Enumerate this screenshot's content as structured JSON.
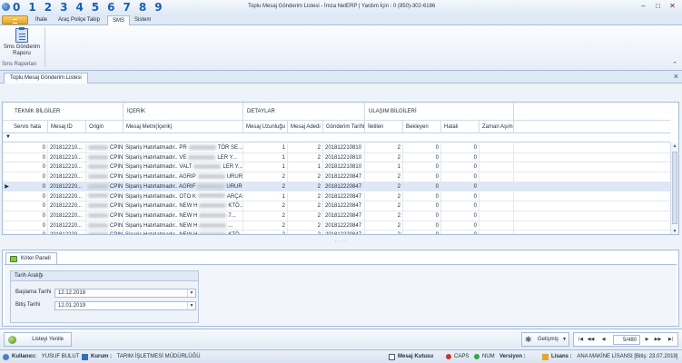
{
  "titlebar": {
    "digits": [
      "0",
      "1",
      "2",
      "3",
      "4",
      "5",
      "6",
      "7",
      "8",
      "9"
    ],
    "title": "Toplu Mesaj Gönderim Listesi - İmza NetERP | Yardım İçin :  0 (850)-302-6186"
  },
  "ribbon": {
    "tabs": [
      "İhale",
      "Araç Poliçe Takip",
      "SMS",
      "Sistem"
    ],
    "active_tab": "SMS",
    "button_label_1": "Sms Gönderim",
    "button_label_2": "Raporu",
    "group_label": "Sms Raporları"
  },
  "document_tab": "Toplu Mesaj Gönderim Listesi",
  "grid": {
    "bands": [
      "TEKNİK BİLGİLER",
      "İÇERİK",
      "DETAYLAR",
      "ULAŞIM BİLGİLERİ"
    ],
    "columns": [
      "Servis hata",
      "Mesaj ID",
      "Origin",
      "Mesaj Metni(İçerik)",
      "Mesaj Uzunluğu",
      "Mesaj Adedi",
      "Gönderim Tarihi",
      "İletilen",
      "Bekleyen",
      "Hatalı",
      "Zaman Aşımı"
    ],
    "rows": [
      {
        "servis": "0",
        "id": "201812210...",
        "origin": "CPIN...",
        "text_a": "Sipariş Hatırlatmadır.. PR",
        "text_b": "TÖR SE...",
        "uzunluk": "1",
        "adet": "2",
        "tarih": "201812210810",
        "iletilen": "2",
        "bekleyen": "0",
        "hatali": "0"
      },
      {
        "servis": "0",
        "id": "201812210...",
        "origin": "CPIN...",
        "text_a": "Sipariş Hatırlatmadır.. VE",
        "text_b": "LER Y...",
        "uzunluk": "1",
        "adet": "2",
        "tarih": "201812210810",
        "iletilen": "2",
        "bekleyen": "0",
        "hatali": "0"
      },
      {
        "servis": "0",
        "id": "201812210...",
        "origin": "CPIN...",
        "text_a": "Sipariş Hatırlatmadır.. VALT",
        "text_b": "LER Y...",
        "uzunluk": "1",
        "adet": "1",
        "tarih": "201812210810",
        "iletilen": "1",
        "bekleyen": "0",
        "hatali": "0"
      },
      {
        "servis": "0",
        "id": "201812220...",
        "origin": "CPIN...",
        "text_a": "Sipariş Hatırlatmadır.. AGRIP",
        "text_b": "URUR ...",
        "uzunluk": "2",
        "adet": "2",
        "tarih": "201812220847",
        "iletilen": "2",
        "bekleyen": "0",
        "hatali": "0"
      },
      {
        "servis": "0",
        "id": "201812220...",
        "origin": "CPIN...",
        "text_a": "Sipariş Hatırlatmadır.. AGRIF",
        "text_b": "URUR ...",
        "uzunluk": "2",
        "adet": "2",
        "tarih": "201812220847",
        "iletilen": "2",
        "bekleyen": "0",
        "hatali": "0"
      },
      {
        "servis": "0",
        "id": "201812220...",
        "origin": "CPIN...",
        "text_a": "Sipariş Hatırlatmadır.. OTO K",
        "text_b": "ARÇAL...",
        "uzunluk": "1",
        "adet": "2",
        "tarih": "201812220847",
        "iletilen": "2",
        "bekleyen": "0",
        "hatali": "0"
      },
      {
        "servis": "0",
        "id": "201812220...",
        "origin": "CPIN...",
        "text_a": "Sipariş Hatırlatmadır.. NEW H",
        "text_b": "KTÖ...",
        "uzunluk": "2",
        "adet": "2",
        "tarih": "201812220847",
        "iletilen": "2",
        "bekleyen": "0",
        "hatali": "0"
      },
      {
        "servis": "0",
        "id": "201812220...",
        "origin": "CPIN...",
        "text_a": "Sipariş Hatırlatmadır.. NEW H",
        "text_b": "7...",
        "uzunluk": "2",
        "adet": "2",
        "tarih": "201812220847",
        "iletilen": "2",
        "bekleyen": "0",
        "hatali": "0"
      },
      {
        "servis": "0",
        "id": "201812220...",
        "origin": "CPIN...",
        "text_a": "Sipariş Hatırlatmadır.. NEW H",
        "text_b": "...",
        "uzunluk": "2",
        "adet": "2",
        "tarih": "201812220847",
        "iletilen": "2",
        "bekleyen": "0",
        "hatali": "0"
      },
      {
        "servis": "0",
        "id": "201812220...",
        "origin": "CPIN...",
        "text_a": "Sipariş Hatırlatmadır.. NEW H",
        "text_b": "KTÖ...",
        "uzunluk": "2",
        "adet": "2",
        "tarih": "201812220847",
        "iletilen": "2",
        "bekleyen": "0",
        "hatali": "0"
      }
    ],
    "selected_row": 4
  },
  "panel": {
    "tab": "Kriter Paneli",
    "group_title": "Tarih Aralığı",
    "start_label": "Başlama Tarihi",
    "start_value": "12.12.2018",
    "end_label": "Bitiş Tarihi",
    "end_value": "12.01.2019"
  },
  "actions": {
    "refresh": "Listeyi Yenile",
    "advanced": "Gelişmiş",
    "page_count": "5/480"
  },
  "status": {
    "user_label": "Kullanıcı:",
    "user_value": "YUSUF BULUT",
    "org_label": "Kurum :",
    "org_value": "TARIM İŞLETMESİ MÜDÜRLÜĞÜ",
    "inbox": "Mesaj Kutusu",
    "caps": "CAPS",
    "num": "NUM",
    "version_label": "Versiyon :",
    "license_label": "Lisans :",
    "license_value": "ANA MAKİNE LİSANSI [Bitiş: 23.07.2019]"
  }
}
